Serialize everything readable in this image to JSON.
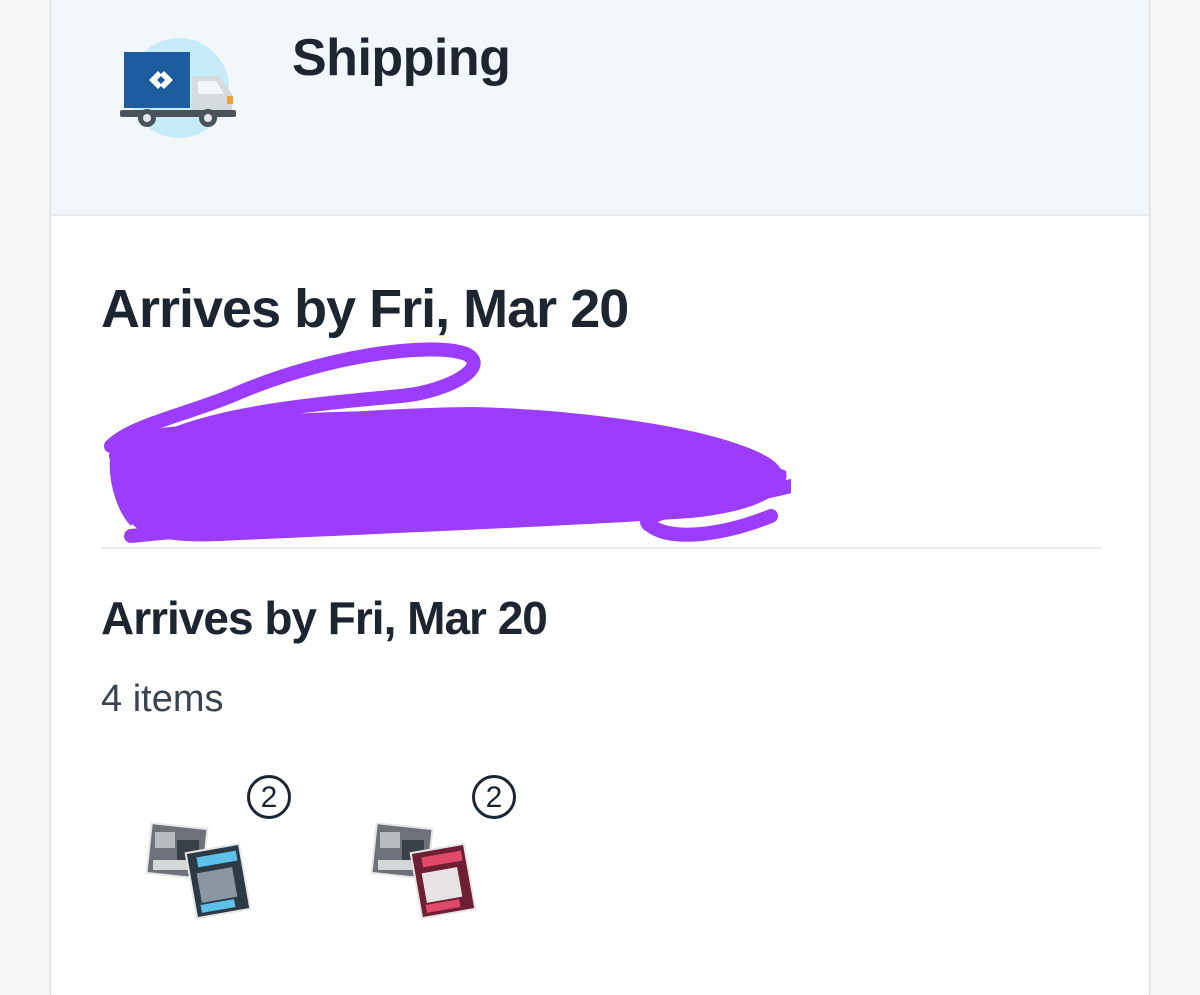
{
  "header": {
    "title": "Shipping",
    "icon": "delivery-truck-icon"
  },
  "shipment_1": {
    "arrival": "Arrives by Fri, Mar 20"
  },
  "shipment_2": {
    "arrival": "Arrives by Fri, Mar 20",
    "items_count": "4 items",
    "products": [
      {
        "quantity": "2",
        "image": "trading-card-boxes-blue"
      },
      {
        "quantity": "2",
        "image": "trading-card-boxes-red"
      }
    ]
  },
  "colors": {
    "header_bg": "#f2f7fc",
    "text": "#1d2630",
    "scribble": "#9b3cff",
    "truck_blue": "#1d5c9e",
    "truck_circle": "#c6ecf7"
  }
}
